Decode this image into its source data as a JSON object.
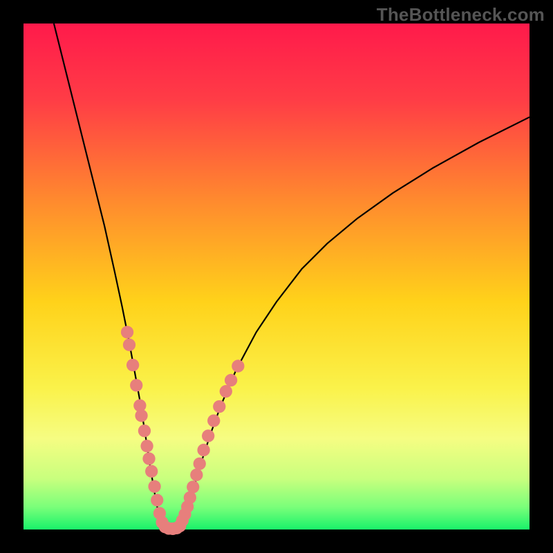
{
  "watermark": "TheBottleneck.com",
  "chart_data": {
    "type": "line",
    "title": "",
    "xlabel": "",
    "ylabel": "",
    "xlim": [
      0,
      100
    ],
    "ylim": [
      0,
      100
    ],
    "legend": false,
    "grid": false,
    "background_gradient_stops": [
      {
        "pos": 0.0,
        "color": "#ff1a4b"
      },
      {
        "pos": 0.15,
        "color": "#ff3c46"
      },
      {
        "pos": 0.35,
        "color": "#ff8a2e"
      },
      {
        "pos": 0.55,
        "color": "#ffd21a"
      },
      {
        "pos": 0.72,
        "color": "#faf24a"
      },
      {
        "pos": 0.82,
        "color": "#f6fd82"
      },
      {
        "pos": 0.9,
        "color": "#c8ff7e"
      },
      {
        "pos": 0.955,
        "color": "#7bff7a"
      },
      {
        "pos": 1.0,
        "color": "#19f26a"
      }
    ],
    "series": [
      {
        "name": "left-branch",
        "x": [
          6,
          8,
          10,
          12,
          14,
          16,
          18,
          19.5,
          20.8,
          22,
          23,
          23.8,
          24.5,
          25.1,
          25.7,
          26.2,
          26.7,
          27.2,
          27.8
        ],
        "y": [
          100,
          92,
          84,
          76,
          68,
          60,
          51,
          44,
          37.5,
          31,
          25.5,
          20.5,
          16,
          12,
          8.5,
          5.5,
          3.2,
          1.4,
          0.2
        ]
      },
      {
        "name": "flat-min",
        "x": [
          27.8,
          28.5,
          29.0,
          29.5,
          30.0,
          30.5,
          30.9
        ],
        "y": [
          0.2,
          0.05,
          0.0,
          0.0,
          0.0,
          0.05,
          0.2
        ]
      },
      {
        "name": "right-branch",
        "x": [
          30.9,
          31.5,
          32.2,
          33,
          34,
          35.2,
          37,
          39,
          42,
          46,
          50,
          55,
          60,
          66,
          73,
          81,
          90,
          100
        ],
        "y": [
          0.2,
          1.6,
          3.5,
          6,
          9.5,
          13.5,
          19,
          24.5,
          31.5,
          39,
          45,
          51.5,
          56.5,
          61.5,
          66.5,
          71.5,
          76.5,
          81.5
        ]
      }
    ],
    "scatter_overlay": {
      "name": "pink-dots",
      "color": "#e77f7c",
      "radius_pct": 1.25,
      "points": [
        {
          "x": 20.5,
          "y": 39
        },
        {
          "x": 20.9,
          "y": 36.5
        },
        {
          "x": 21.6,
          "y": 32.5
        },
        {
          "x": 22.3,
          "y": 28.5
        },
        {
          "x": 23.0,
          "y": 24.5
        },
        {
          "x": 23.3,
          "y": 22.5
        },
        {
          "x": 23.9,
          "y": 19.5
        },
        {
          "x": 24.4,
          "y": 16.5
        },
        {
          "x": 24.8,
          "y": 14
        },
        {
          "x": 25.3,
          "y": 11.5
        },
        {
          "x": 25.9,
          "y": 8.5
        },
        {
          "x": 26.4,
          "y": 5.8
        },
        {
          "x": 26.9,
          "y": 3.2
        },
        {
          "x": 27.4,
          "y": 1.4
        },
        {
          "x": 28.0,
          "y": 0.5
        },
        {
          "x": 28.7,
          "y": 0.2
        },
        {
          "x": 29.5,
          "y": 0.15
        },
        {
          "x": 30.3,
          "y": 0.3
        },
        {
          "x": 30.9,
          "y": 0.7
        },
        {
          "x": 31.4,
          "y": 1.8
        },
        {
          "x": 31.9,
          "y": 3.0
        },
        {
          "x": 32.4,
          "y": 4.5
        },
        {
          "x": 32.9,
          "y": 6.3
        },
        {
          "x": 33.5,
          "y": 8.4
        },
        {
          "x": 34.2,
          "y": 10.8
        },
        {
          "x": 34.8,
          "y": 13
        },
        {
          "x": 35.6,
          "y": 15.7
        },
        {
          "x": 36.5,
          "y": 18.5
        },
        {
          "x": 37.6,
          "y": 21.5
        },
        {
          "x": 38.7,
          "y": 24.3
        },
        {
          "x": 40.0,
          "y": 27.3
        },
        {
          "x": 41.0,
          "y": 29.5
        },
        {
          "x": 42.4,
          "y": 32.3
        }
      ]
    }
  }
}
